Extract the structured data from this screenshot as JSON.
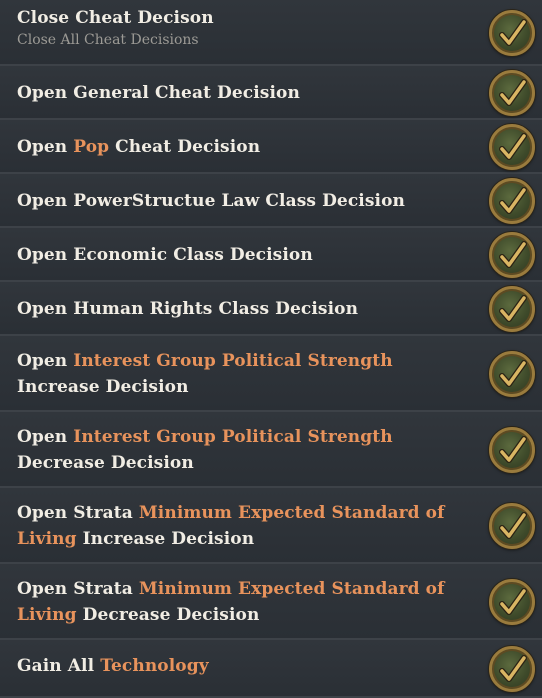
{
  "decisions": [
    {
      "title_parts": [
        {
          "text": "Close Cheat Decison",
          "hl": false
        }
      ],
      "subtitle": "Close All Cheat Decisions"
    },
    {
      "title_parts": [
        {
          "text": "Open General Cheat Decision",
          "hl": false
        }
      ]
    },
    {
      "title_parts": [
        {
          "text": "Open ",
          "hl": false
        },
        {
          "text": "Pop",
          "hl": true
        },
        {
          "text": " Cheat Decision",
          "hl": false
        }
      ]
    },
    {
      "title_parts": [
        {
          "text": "Open PowerStructue Law Class Decision",
          "hl": false
        }
      ]
    },
    {
      "title_parts": [
        {
          "text": "Open Economic Class Decision",
          "hl": false
        }
      ]
    },
    {
      "title_parts": [
        {
          "text": "Open Human Rights Class Decision",
          "hl": false
        }
      ]
    },
    {
      "title_parts": [
        {
          "text": "Open ",
          "hl": false
        },
        {
          "text": "Interest Group Political Strength",
          "hl": true
        },
        {
          "text": " Increase Decision",
          "hl": false
        }
      ]
    },
    {
      "title_parts": [
        {
          "text": "Open ",
          "hl": false
        },
        {
          "text": "Interest Group Political Strength",
          "hl": true
        },
        {
          "text": " Decrease Decision",
          "hl": false
        }
      ]
    },
    {
      "title_parts": [
        {
          "text": "Open Strata ",
          "hl": false
        },
        {
          "text": "Minimum Expected Standard of Living",
          "hl": true
        },
        {
          "text": " Increase Decision",
          "hl": false
        }
      ]
    },
    {
      "title_parts": [
        {
          "text": "Open Strata ",
          "hl": false
        },
        {
          "text": "Minimum Expected Standard of Living",
          "hl": true
        },
        {
          "text": " Decrease Decision",
          "hl": false
        }
      ]
    },
    {
      "title_parts": [
        {
          "text": "Gain All ",
          "hl": false
        },
        {
          "text": "Technology",
          "hl": true
        }
      ]
    }
  ],
  "colors": {
    "text": "#f1ede4",
    "highlight": "#e8935c",
    "subtitle": "#9c9a95",
    "check_ring": "#9a7b3d",
    "check_mark": "#d9b563"
  },
  "icons": {
    "confirm": "checkmark-icon"
  }
}
